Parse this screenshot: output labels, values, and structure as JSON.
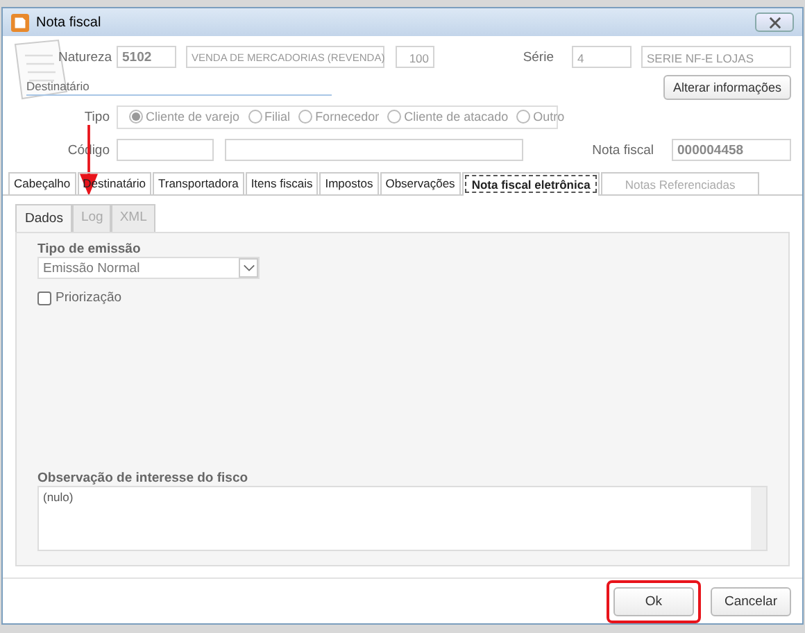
{
  "window": {
    "title": "Nota fiscal"
  },
  "header": {
    "natureza": {
      "label": "Natureza",
      "code": "5102",
      "description": "VENDA DE MERCADORIAS (REVENDA)",
      "number": "100"
    },
    "serie": {
      "label": "Série",
      "code": "4",
      "description": "SERIE NF-E LOJAS"
    },
    "destinatario_label": "Destinatário",
    "alter_button": "Alterar informações",
    "tipo": {
      "label": "Tipo",
      "options": [
        {
          "label": "Cliente de varejo",
          "selected": true
        },
        {
          "label": "Filial",
          "selected": false
        },
        {
          "label": "Fornecedor",
          "selected": false
        },
        {
          "label": "Cliente de atacado",
          "selected": false
        },
        {
          "label": "Outro",
          "selected": false
        }
      ]
    },
    "codigo_label": "Código",
    "nota_fiscal": {
      "label": "Nota fiscal",
      "value": "000004458"
    }
  },
  "tabs": [
    {
      "label": "Cabeçalho",
      "selected": false,
      "disabled": false
    },
    {
      "label": "Destinatário",
      "selected": false,
      "disabled": false
    },
    {
      "label": "Transportadora",
      "selected": false,
      "disabled": false
    },
    {
      "label": "Itens fiscais",
      "selected": false,
      "disabled": false
    },
    {
      "label": "Impostos",
      "selected": false,
      "disabled": false
    },
    {
      "label": "Observações",
      "selected": false,
      "disabled": false
    },
    {
      "label": "Nota fiscal eletrônica",
      "selected": true,
      "disabled": false
    },
    {
      "label": "Notas Referenciadas",
      "selected": false,
      "disabled": true
    }
  ],
  "subtabs": [
    {
      "label": "Dados",
      "selected": true,
      "disabled": false
    },
    {
      "label": "Log",
      "selected": false,
      "disabled": true
    },
    {
      "label": "XML",
      "selected": false,
      "disabled": true
    }
  ],
  "tipo_emissao": {
    "label": "Tipo de emissão",
    "value": "Emissão Normal"
  },
  "priorizacao": {
    "label": "Priorização",
    "checked": false
  },
  "observacao": {
    "label": "Observação de interesse do fisco",
    "value": "(nulo)"
  },
  "annotation_arrow": true,
  "buttons": [
    {
      "label": "Ok",
      "highlighted": true
    },
    {
      "label": "Cancelar",
      "highlighted": false
    }
  ]
}
